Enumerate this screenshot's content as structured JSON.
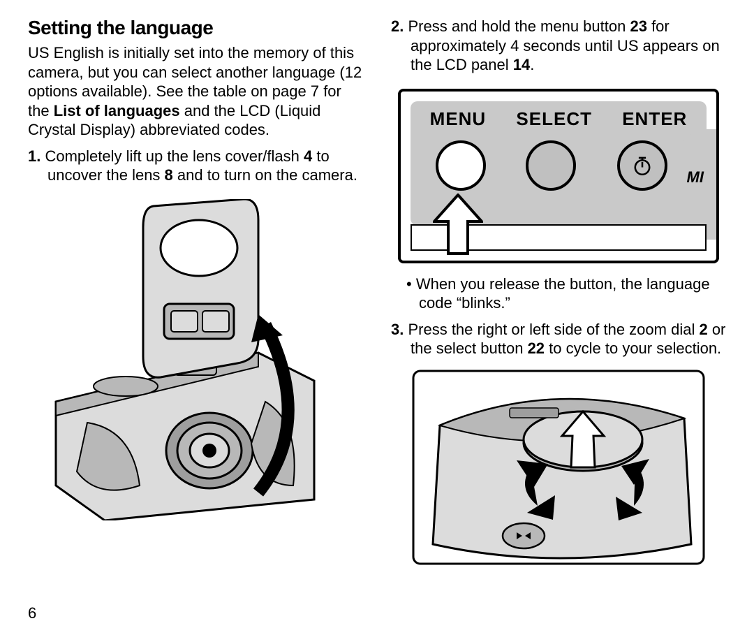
{
  "heading": "Setting the language",
  "intro_parts": {
    "a": "US English is initially set into the memory of this camera, but you can select another language (12 options available). See the table on page 7 for the ",
    "b": "List of languages",
    "c": " and the LCD (Liquid Crystal Display) abbreviated codes."
  },
  "step1": {
    "num": "1.",
    "a": " Completely lift up the lens cover/flash ",
    "ref4": "4",
    "b": " to uncover the lens ",
    "ref8": "8",
    "c": " and to turn on the camera."
  },
  "step2": {
    "num": "2.",
    "a": " Press and hold the menu button ",
    "ref23": "23",
    "b": " for approximately 4 seconds until US appears on the LCD panel ",
    "ref14": "14",
    "c": "."
  },
  "panel": {
    "menu": "MENU",
    "select": "SELECT",
    "enter": "ENTER",
    "side": "MI"
  },
  "bullet1": "When you release the button, the language code “blinks.”",
  "step3": {
    "num": "3.",
    "a": " Press the right or left side of the zoom dial ",
    "ref2": "2",
    "b": " or the select button ",
    "ref22": "22",
    "c": " to cycle to your selection."
  },
  "page_number": "6"
}
